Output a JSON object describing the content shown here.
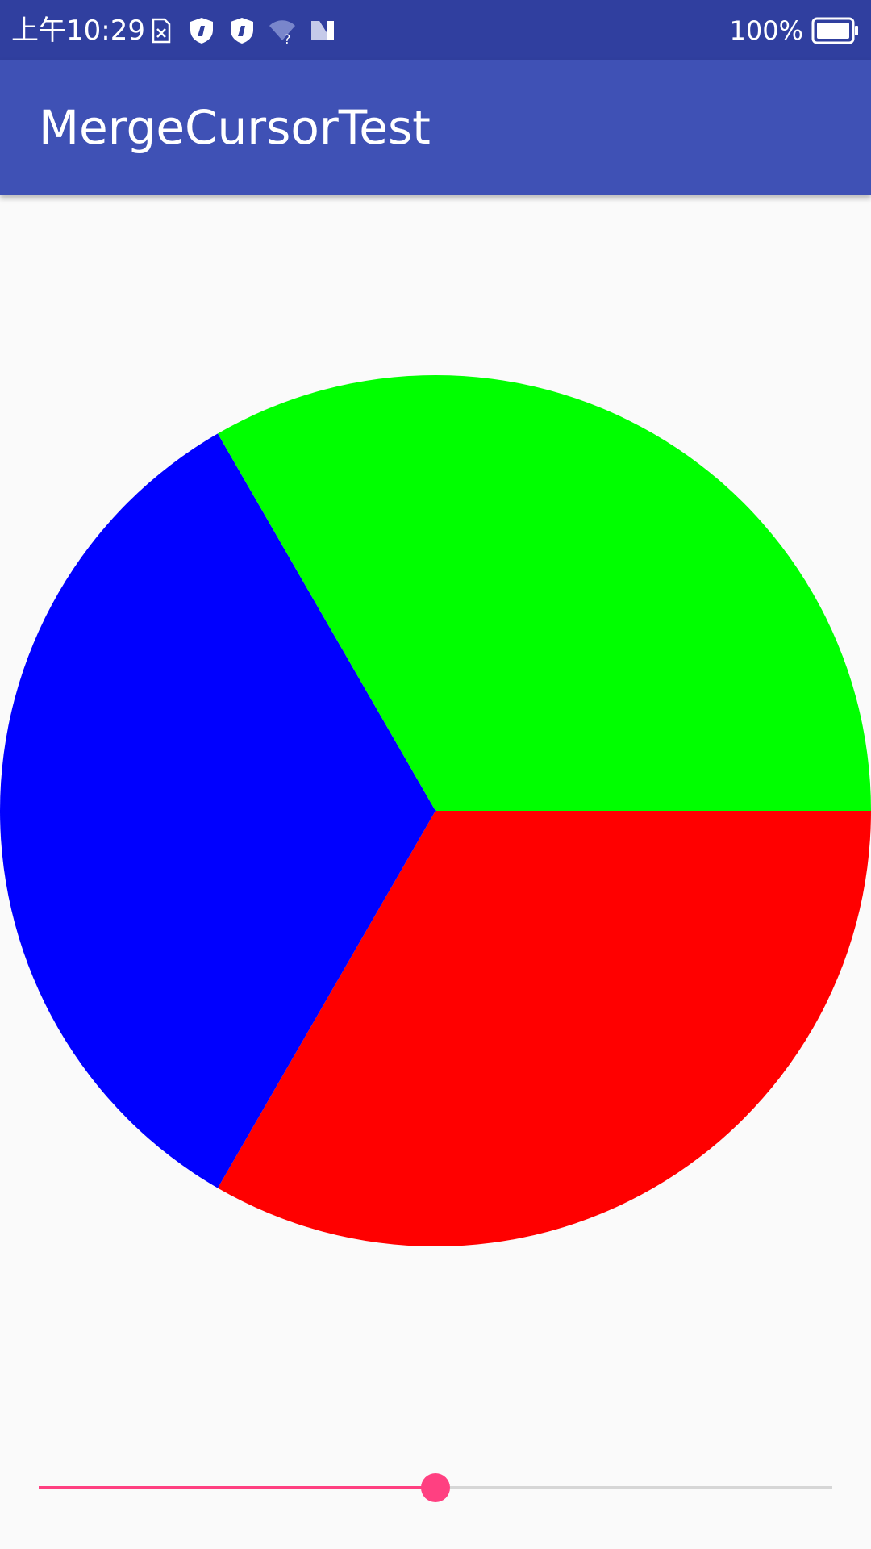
{
  "status_bar": {
    "time": "上午10:29",
    "battery": "100%",
    "icons": [
      "sim-missing-icon",
      "shield-a-icon",
      "shield-b-icon",
      "wifi-unknown-icon",
      "nfc-icon",
      "battery-full-icon"
    ],
    "background": "#303f9f"
  },
  "app_bar": {
    "title": "MergeCursorTest",
    "background": "#3f51b5"
  },
  "chart_data": {
    "type": "pie",
    "start_angle_deg": 0,
    "direction": "clockwise",
    "slices": [
      {
        "value": 1,
        "color": "#ff0000"
      },
      {
        "value": 1,
        "color": "#0000ff"
      },
      {
        "value": 1,
        "color": "#00ff00"
      }
    ]
  },
  "seekbar": {
    "progress": 0.5,
    "accent": "#ff4081",
    "track": "#d6d6d6"
  }
}
